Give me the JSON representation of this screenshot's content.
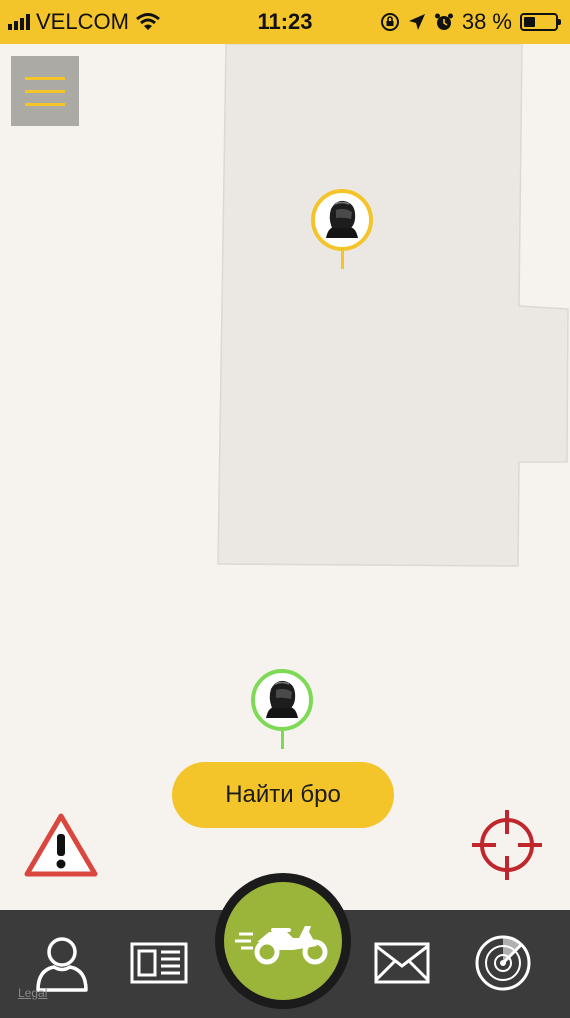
{
  "status_bar": {
    "carrier": "VELCOM",
    "time": "11:23",
    "battery_text": "38 %",
    "battery_level": 0.38,
    "icons": [
      "signal-icon",
      "wifi-icon",
      "orientation-lock-icon",
      "location-arrow-icon",
      "alarm-icon",
      "battery-icon"
    ]
  },
  "map": {
    "menu_icon": "hamburger-icon",
    "markers": [
      {
        "name": "bro-marker",
        "ring_color": "#f3c52a",
        "icon": "helmet-icon"
      },
      {
        "name": "my-location-marker",
        "ring_color": "#7ed957",
        "icon": "helmet-icon"
      }
    ],
    "find_bro_label": "Найти бро",
    "alert_icon": "warning-icon",
    "locate_icon": "crosshair-icon",
    "legal_label": "Legal"
  },
  "bottom_nav": {
    "items": [
      {
        "name": "profile",
        "icon": "person-icon"
      },
      {
        "name": "news",
        "icon": "newspaper-icon"
      },
      {
        "name": "ride",
        "icon": "motorcycle-icon"
      },
      {
        "name": "messages",
        "icon": "envelope-icon"
      },
      {
        "name": "radar",
        "icon": "radar-icon"
      }
    ]
  },
  "colors": {
    "accent": "#f3c52a",
    "nav_background": "#3b3b3b",
    "ride_button": "#9bb43a",
    "alert": "#d9473f",
    "locate": "#c0272d",
    "me_marker": "#7ed957"
  }
}
